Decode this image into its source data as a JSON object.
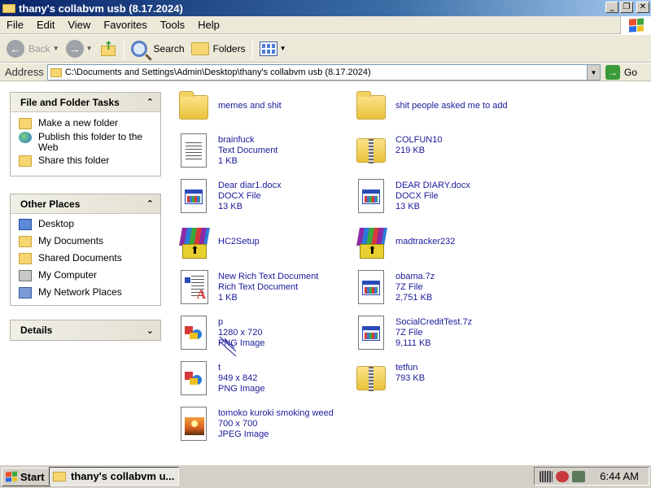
{
  "window": {
    "title": "thany's collabvm usb (8.17.2024)"
  },
  "menu": [
    "File",
    "Edit",
    "View",
    "Favorites",
    "Tools",
    "Help"
  ],
  "toolbar": {
    "back": "Back",
    "search": "Search",
    "folders": "Folders"
  },
  "address": {
    "label": "Address",
    "path": "C:\\Documents and Settings\\Admin\\Desktop\\thany's collabvm usb (8.17.2024)",
    "go": "Go"
  },
  "tasks_panel": {
    "title": "File and Folder Tasks",
    "items": [
      "Make a new folder",
      "Publish this folder to the Web",
      "Share this folder"
    ]
  },
  "places_panel": {
    "title": "Other Places",
    "items": [
      "Desktop",
      "My Documents",
      "Shared Documents",
      "My Computer",
      "My Network Places"
    ]
  },
  "details_panel": {
    "title": "Details"
  },
  "files": [
    {
      "name": "memes and shit",
      "type": "",
      "size": "",
      "icon": "folder-icon"
    },
    {
      "name": "shit people asked me to add",
      "type": "",
      "size": "",
      "icon": "folder-icon"
    },
    {
      "name": "brainfuck",
      "type": "Text Document",
      "size": "1 KB",
      "icon": "text-document-icon"
    },
    {
      "name": "COLFUN10",
      "type": "219 KB",
      "size": "",
      "icon": "zip-folder-icon"
    },
    {
      "name": "Dear diar1.docx",
      "type": "DOCX File",
      "size": "13 KB",
      "icon": "unknown-file-icon"
    },
    {
      "name": "DEAR DIARY.docx",
      "type": "DOCX File",
      "size": "13 KB",
      "icon": "unknown-file-icon"
    },
    {
      "name": "HC2Setup",
      "type": "",
      "size": "",
      "icon": "winrar-installer-icon"
    },
    {
      "name": "madtracker232",
      "type": "",
      "size": "",
      "icon": "winrar-installer-icon"
    },
    {
      "name": "New Rich Text Document",
      "type": "Rich Text Document",
      "size": "1 KB",
      "icon": "rich-text-icon"
    },
    {
      "name": "obama.7z",
      "type": "7Z File",
      "size": "2,751 KB",
      "icon": "unknown-file-icon"
    },
    {
      "name": "p",
      "type": "1280 x 720",
      "size": "PNG Image",
      "icon": "png-image-icon"
    },
    {
      "name": "SocialCreditTest.7z",
      "type": "7Z File",
      "size": "9,111 KB",
      "icon": "unknown-file-icon"
    },
    {
      "name": "t",
      "type": "949 x 842",
      "size": "PNG Image",
      "icon": "png-image-icon"
    },
    {
      "name": "tetfun",
      "type": "793 KB",
      "size": "",
      "icon": "zip-folder-icon"
    },
    {
      "name": "tomoko kuroki smoking weed",
      "type": "700 x 700",
      "size": "JPEG Image",
      "icon": "jpeg-image-icon"
    }
  ],
  "taskbar": {
    "start": "Start",
    "window_button": "thany's collabvm u...",
    "clock": "6:44 AM"
  }
}
